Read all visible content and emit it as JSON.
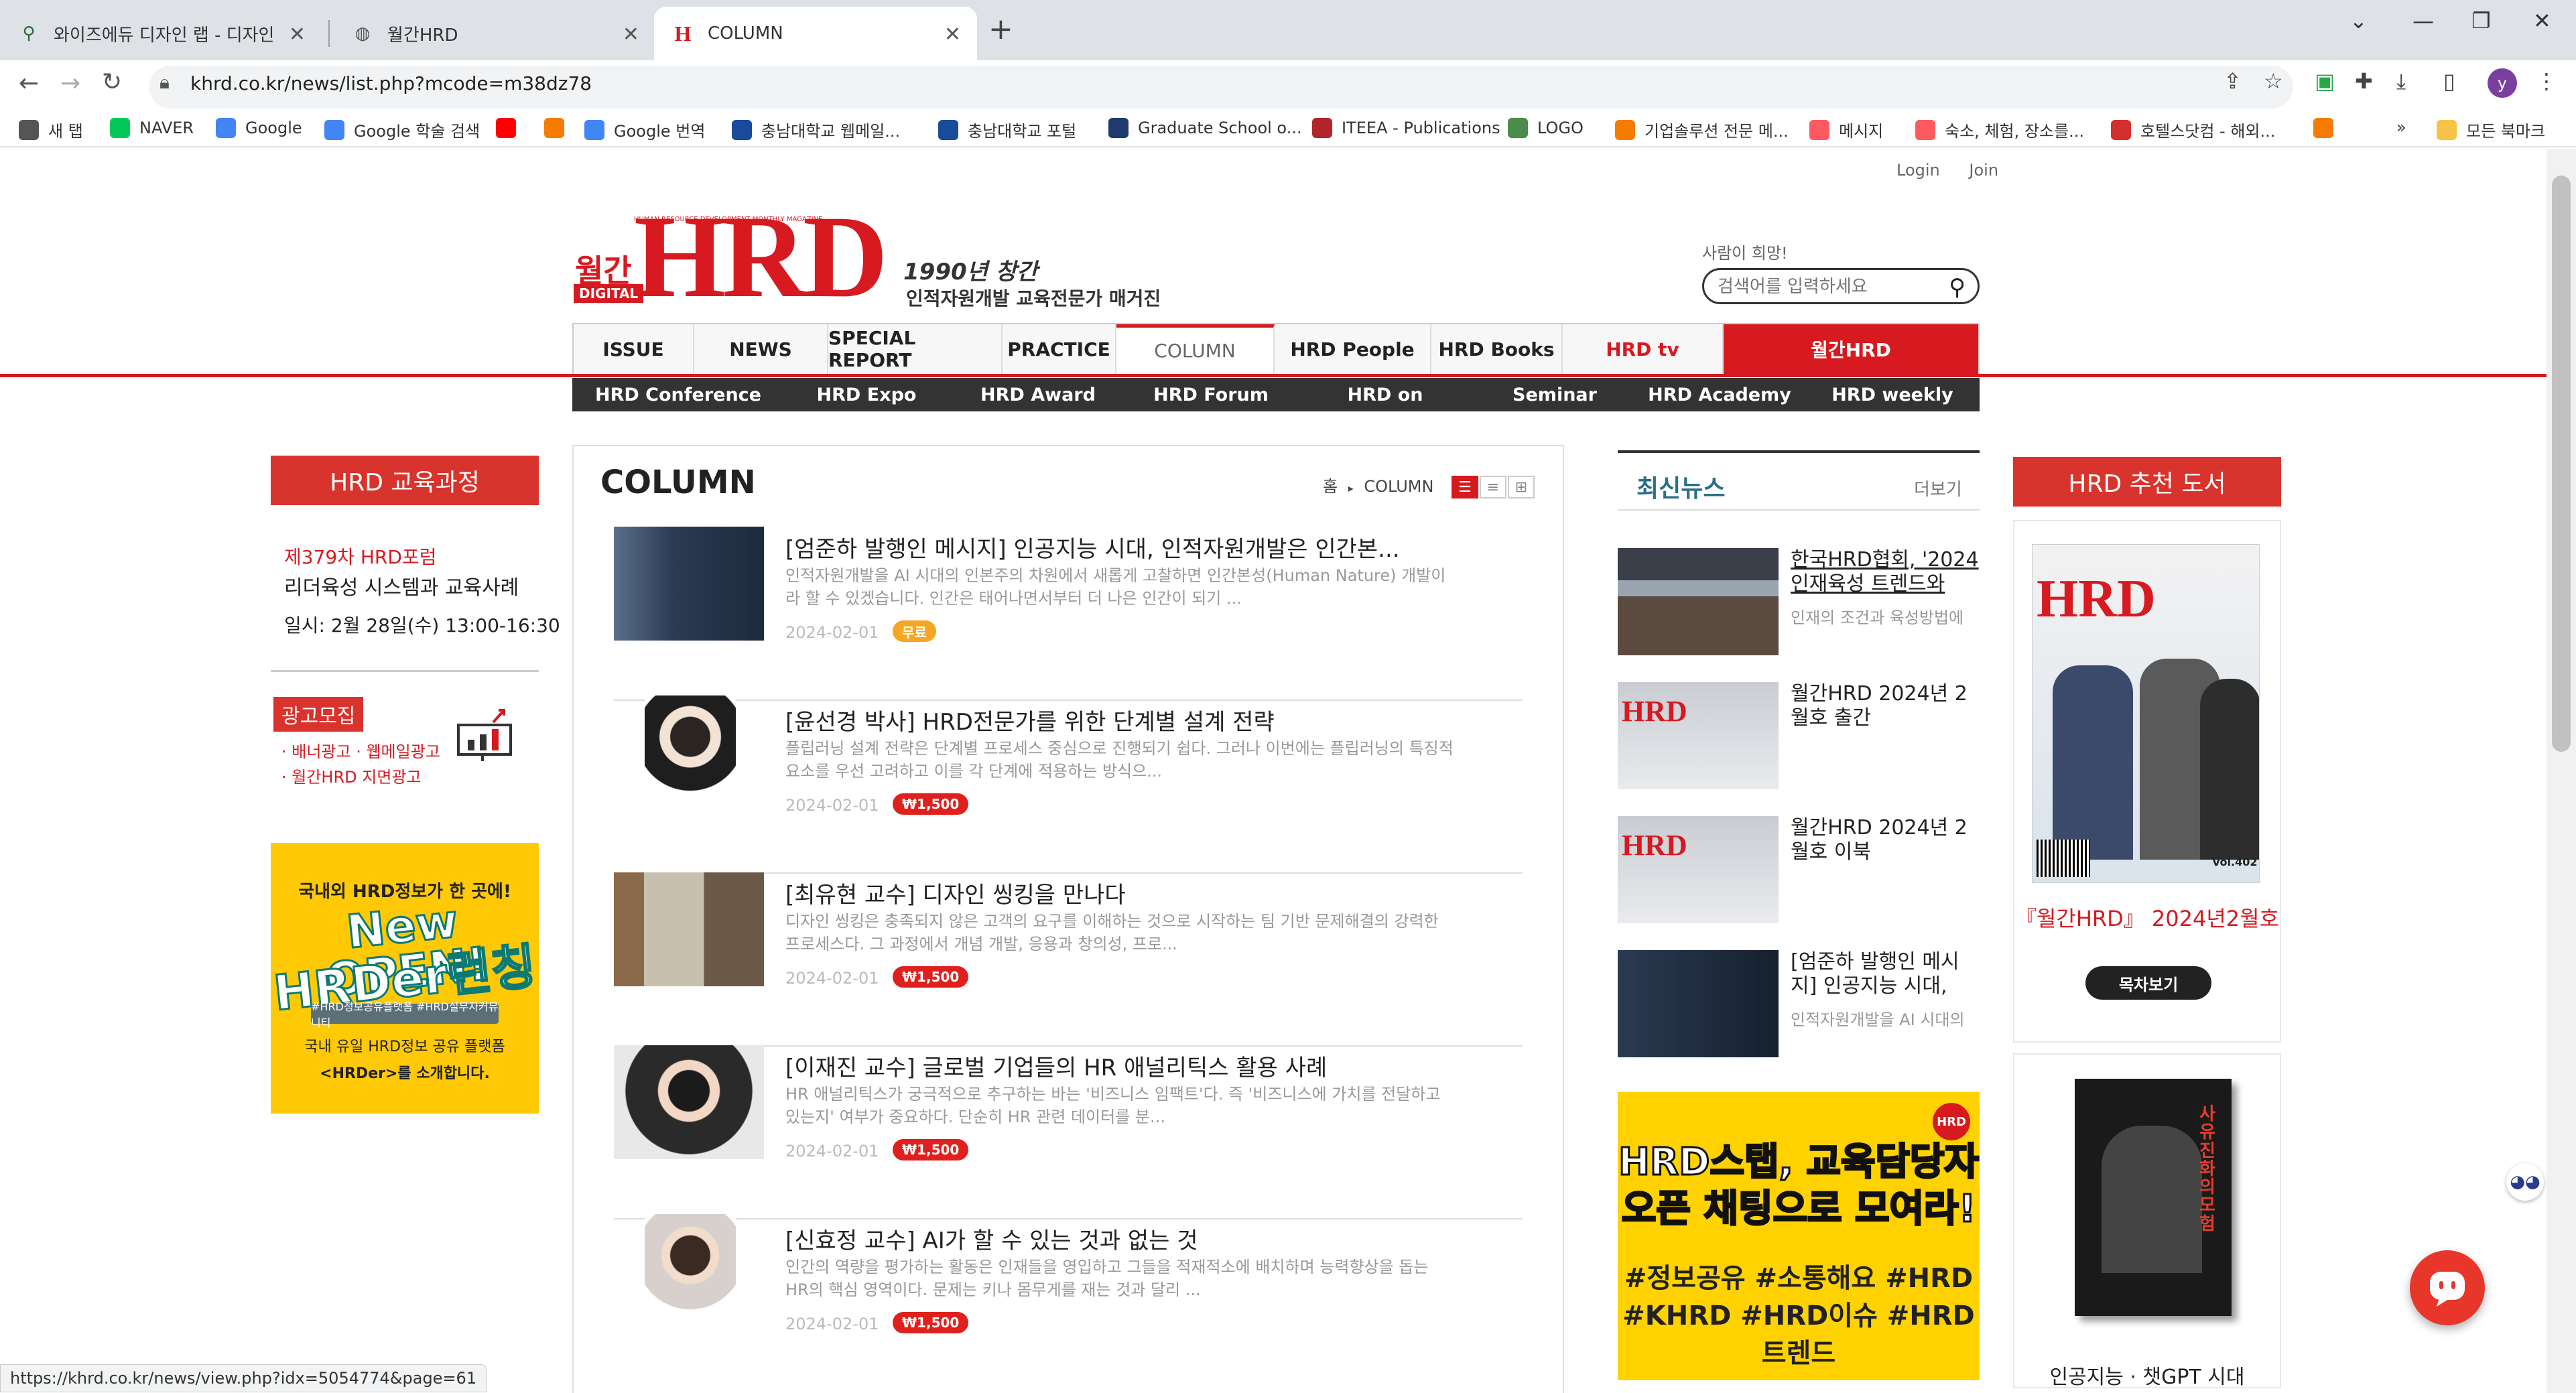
{
  "browser": {
    "tabs": [
      {
        "title": "와이즈에듀 디자인 랩 - 디자인",
        "active": false
      },
      {
        "title": "월간HRD",
        "active": false
      },
      {
        "title": "COLUMN",
        "active": true
      }
    ],
    "new_tab": "+",
    "url": "khrd.co.kr/news/list.php?mcode=m38dz78",
    "profile_initial": "y",
    "bookmarks": [
      {
        "label": "새 탭",
        "icon": "globe-icon",
        "color": "#555"
      },
      {
        "label": "NAVER",
        "icon": "naver-icon",
        "color": "#03c75a"
      },
      {
        "label": "Google",
        "icon": "google-icon",
        "color": "#4285f4"
      },
      {
        "label": "Google 학술 검색",
        "icon": "scholar-icon",
        "color": "#4285f4"
      },
      {
        "label": "",
        "icon": "youtube-icon",
        "color": "#ff0000"
      },
      {
        "label": "",
        "icon": "m-icon",
        "color": "#f57c00"
      },
      {
        "label": "Google 번역",
        "icon": "translate-icon",
        "color": "#4285f4"
      },
      {
        "label": "충남대학교 웹메일...",
        "icon": "cnu-icon",
        "color": "#1a4b9b"
      },
      {
        "label": "충남대학교 포털",
        "icon": "cnu-portal-icon",
        "color": "#1a4b9b"
      },
      {
        "label": "Graduate School o...",
        "icon": "ut-icon",
        "color": "#1f3b6d"
      },
      {
        "label": "ITEEA - Publications",
        "icon": "iteea-icon",
        "color": "#b1252b"
      },
      {
        "label": "LOGO",
        "icon": "logo-icon",
        "color": "#4c8c4a"
      },
      {
        "label": "기업솔루션 전문 메...",
        "icon": "m-icon",
        "color": "#f57c00"
      },
      {
        "label": "메시지",
        "icon": "airbnb-icon",
        "color": "#ff5a5f"
      },
      {
        "label": "숙소, 체험, 장소를...",
        "icon": "airbnb-icon",
        "color": "#ff5a5f"
      },
      {
        "label": "호텔스닷컴 - 해외...",
        "icon": "hotels-icon",
        "color": "#d32f2f"
      },
      {
        "label": "",
        "icon": "m-icon",
        "color": "#f57c00"
      }
    ],
    "bookmarks_overflow": "»",
    "all_bookmarks": "모든 북마크",
    "status_url": "https://khrd.co.kr/news/view.php?idx=5054774&page=61"
  },
  "site": {
    "top_links": {
      "login": "Login",
      "join": "Join"
    },
    "logo": {
      "wolgan": "월간",
      "digital": "DIGITAL",
      "hrd": "HRD",
      "tagline1": "1990년 창간",
      "tagline2": "인적자원개발 교육전문가 매거진",
      "tiny": "HUMAN RESOURCE DEVELOPMENT MONTHLY MAGAZINE"
    },
    "search": {
      "hint": "사람이 희망!",
      "placeholder": "검색어를 입력하세요"
    },
    "gnb": [
      {
        "label": "ISSUE",
        "w": 0
      },
      {
        "label": "NEWS"
      },
      {
        "label": "SPECIAL REPORT"
      },
      {
        "label": "PRACTICE"
      },
      {
        "label": "COLUMN"
      },
      {
        "label": "HRD People"
      },
      {
        "label": "HRD Books"
      },
      {
        "label": "HRD tv"
      },
      {
        "label": "월간HRD"
      }
    ],
    "subnav": [
      "HRD Conference",
      "HRD Expo",
      "HRD Award",
      "HRD Forum",
      "HRD on",
      "Seminar",
      "HRD Academy",
      "HRD weekly"
    ],
    "left": {
      "course_title": "HRD 교육과정",
      "forum_no": "제379차 HRD포럼",
      "forum_title": "리더육성 시스템과 교육사례",
      "forum_date": "일시: 2월 28일(수) 13:00-16:30",
      "ad_title": "광고모집",
      "ad_lines": [
        "· 배너광고 · 웹메일광고",
        "· 월간HRD 지면광고"
      ],
      "banner": {
        "line1": "국내외 HRD정보가 한 곳에!",
        "line2": "New OPEN!",
        "line3": "HRDer런칭",
        "tags": "#HRD정보공유플랫폼  #HRD실무자커뮤니티",
        "line4": "국내 유일 HRD정보 공유 플랫폼",
        "line5": "<HRDer>를 소개합니다."
      }
    },
    "main": {
      "title": "COLUMN",
      "breadcrumb": {
        "home": "홈",
        "sep": "▸",
        "current": "COLUMN"
      },
      "articles": [
        {
          "title": "[엄준하 발행인 메시지] 인공지능 시대, 인적자원개발은 인간본...",
          "desc": "인적자원개발을 AI 시대의 인본주의 차원에서 새롭게 고찰하면 인간본성(Human Nature) 개발이라 할 수 있겠습니다. 인간은 태어나면서부터 더 나은 인간이 되기 ...",
          "date": "2024-02-01",
          "price": "무료",
          "price_color": "#f5a623"
        },
        {
          "title": "[윤선경 박사] HRD전문가를 위한 단계별 설계 전략",
          "desc": "플립러닝 설계 전략은 단계별 프로세스 중심으로 진행되기 쉽다. 그러나 이번에는 플립러닝의 특징적 요소를 우선 고려하고 이를 각 단계에 적용하는 방식으...",
          "date": "2024-02-01",
          "price": "₩1,500",
          "price_color": "#e0201c"
        },
        {
          "title": "[최유현 교수] 디자인 씽킹을 만나다",
          "desc": "디자인 씽킹은 충족되지 않은 고객의 요구를 이해하는 것으로 시작하는 팀 기반 문제해결의 강력한 프로세스다. 그 과정에서 개념 개발, 응용과 창의성, 프로...",
          "date": "2024-02-01",
          "price": "₩1,500",
          "price_color": "#e0201c"
        },
        {
          "title": "[이재진 교수] 글로벌 기업들의 HR 애널리틱스 활용 사례",
          "desc": "HR 애널리틱스가 궁극적으로 추구하는 바는 '비즈니스 임팩트'다. 즉 '비즈니스에 가치를 전달하고 있는지' 여부가 중요하다. 단순히 HR 관련 데이터를 분...",
          "date": "2024-02-01",
          "price": "₩1,500",
          "price_color": "#e0201c"
        },
        {
          "title": "[신효정 교수] AI가 할 수 있는 것과 없는 것",
          "desc": "인간의 역량을 평가하는 활동은 인재들을 영입하고 그들을 적재적소에 배치하며 능력향상을 돕는 HR의 핵심 영역이다. 문제는 키나 몸무게를 재는 것과 달리 ...",
          "date": "2024-02-01",
          "price": "₩1,500",
          "price_color": "#e0201c"
        }
      ]
    },
    "news": {
      "title": "최신뉴스",
      "more": "더보기",
      "items": [
        {
          "title": "한국HRD협회, '2024 인재육성 트렌드와",
          "desc": "인재의 조건과 육성방법에",
          "underline": true
        },
        {
          "title": "월간HRD 2024년 2월호 출간",
          "desc": "",
          "underline": false
        },
        {
          "title": "월간HRD 2024년 2월호 이북",
          "desc": "",
          "underline": false
        },
        {
          "title": "[엄준하 발행인 메시지] 인공지능 시대,",
          "desc": "인적자원개발을 AI 시대의",
          "underline": false
        }
      ],
      "banner": {
        "badge": "HRD",
        "line1": "HRD스탭, 교육담당자",
        "line2": "오픈 채팅으로 모여라!",
        "line3": "#정보공유 #소통해요 #HRD",
        "line4": "#KHRD #HRD이슈 #HRD트렌드"
      }
    },
    "books": {
      "title": "HRD 추천 도서",
      "book1_caption": "『월간HRD』 2024년2월호",
      "book1_button": "목차보기",
      "book1_cover_logo": "HRD",
      "book1_issue": "Vol.402",
      "book2_caption": "인공지능 · 챗GPT 시대",
      "book2_cover": "사유 진화의 모험"
    }
  },
  "colors": {
    "brand_red": "#d71920",
    "gnb_bg": "#f7f7f7",
    "subnav_bg": "#333333",
    "banner_yellow": "#ffc905"
  }
}
